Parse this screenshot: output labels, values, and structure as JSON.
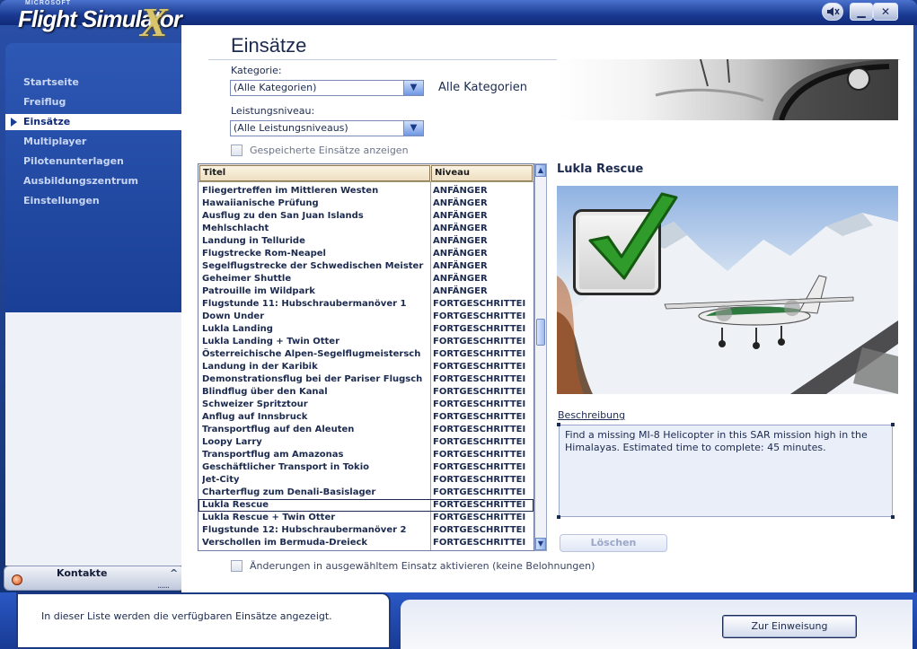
{
  "app": {
    "logo_small": "MICROSOFT",
    "logo_main": "Flight Simulator",
    "logo_x": "X"
  },
  "titlebar": {
    "minimize_label": "▁",
    "close_label": "✕"
  },
  "nav": {
    "items": [
      {
        "label": "Startseite",
        "active": false
      },
      {
        "label": "Freiflug",
        "active": false
      },
      {
        "label": "Einsätze",
        "active": true
      },
      {
        "label": "Multiplayer",
        "active": false
      },
      {
        "label": "Pilotenunterlagen",
        "active": false
      },
      {
        "label": "Ausbildungszentrum",
        "active": false
      },
      {
        "label": "Einstellungen",
        "active": false
      }
    ]
  },
  "contacts": {
    "label": "Kontakte",
    "chevron": "^",
    "grip": "......"
  },
  "page": {
    "title": "Einsätze",
    "category_label": "Kategorie:",
    "category_value": "(Alle Kategorien)",
    "category_display": "Alle Kategorien",
    "level_label": "Leistungsniveau:",
    "level_value": "(Alle Leistungsniveaus)",
    "show_saved_label": "Gespeicherte Einsätze anzeigen"
  },
  "table": {
    "headers": {
      "title": "Titel",
      "level": "Niveau"
    },
    "rows": [
      {
        "title": "Fliegertreffen im Mittleren Westen",
        "level": "ANFÄNGER"
      },
      {
        "title": "Hawaiianische Prüfung",
        "level": "ANFÄNGER"
      },
      {
        "title": "Ausflug zu den San Juan Islands",
        "level": "ANFÄNGER"
      },
      {
        "title": "Mehlschlacht",
        "level": "ANFÄNGER"
      },
      {
        "title": "Landung in Telluride",
        "level": "ANFÄNGER"
      },
      {
        "title": "Flugstrecke Rom-Neapel",
        "level": "ANFÄNGER"
      },
      {
        "title": "Segelflugstrecke der Schwedischen Meister",
        "level": "ANFÄNGER"
      },
      {
        "title": "Geheimer Shuttle",
        "level": "ANFÄNGER"
      },
      {
        "title": "Patrouille im Wildpark",
        "level": "ANFÄNGER"
      },
      {
        "title": "Flugstunde 11: Hubschraubermanöver 1",
        "level": "FORTGESCHRITTEI"
      },
      {
        "title": "Down Under",
        "level": "FORTGESCHRITTEI"
      },
      {
        "title": "Lukla Landing",
        "level": "FORTGESCHRITTEI"
      },
      {
        "title": "Lukla Landing + Twin Otter",
        "level": "FORTGESCHRITTEI"
      },
      {
        "title": "Österreichische Alpen-Segelflugmeistersch",
        "level": "FORTGESCHRITTEI"
      },
      {
        "title": "Landung in der Karibik",
        "level": "FORTGESCHRITTEI"
      },
      {
        "title": "Demonstrationsflug bei der Pariser Flugsch",
        "level": "FORTGESCHRITTEI"
      },
      {
        "title": "Blindflug über den Kanal",
        "level": "FORTGESCHRITTEI"
      },
      {
        "title": "Schweizer Spritztour",
        "level": "FORTGESCHRITTEI"
      },
      {
        "title": "Anflug auf Innsbruck",
        "level": "FORTGESCHRITTEI"
      },
      {
        "title": "Transportflug auf den Aleuten",
        "level": "FORTGESCHRITTEI"
      },
      {
        "title": "Loopy Larry",
        "level": "FORTGESCHRITTEI"
      },
      {
        "title": "Transportflug am Amazonas",
        "level": "FORTGESCHRITTEI"
      },
      {
        "title": "Geschäftlicher Transport in Tokio",
        "level": "FORTGESCHRITTEI"
      },
      {
        "title": "Jet-City",
        "level": "FORTGESCHRITTEI"
      },
      {
        "title": "Charterflug zum Denali-Basislager",
        "level": "FORTGESCHRITTEI"
      },
      {
        "title": "Lukla Rescue",
        "level": "FORTGESCHRITTEI",
        "selected": true
      },
      {
        "title": "Lukla Rescue + Twin Otter",
        "level": "FORTGESCHRITTEI"
      },
      {
        "title": "Flugstunde 12: Hubschraubermanöver 2",
        "level": "FORTGESCHRITTEI"
      },
      {
        "title": "Verschollen im Bermuda-Dreieck",
        "level": "FORTGESCHRITTEI"
      }
    ]
  },
  "scrollbar": {
    "up": "▲",
    "down": "▼",
    "grip": "≡"
  },
  "detail": {
    "mission_title": "Lukla Rescue",
    "description_label": "Beschreibung",
    "description_text": "Find a missing MI-8 Helicopter in this SAR mission high in the Himalayas. Estimated time to complete: 45 minutes.",
    "delete_label": "Löschen",
    "enable_changes_label": "Änderungen in ausgewähltem Einsatz aktivieren (keine Belohnungen)"
  },
  "footer": {
    "status_text": "In dieser Liste werden die verfügbaren Einsätze angezeigt.",
    "briefing_label": "Zur Einweisung"
  },
  "icons": [
    "speaker-muted-icon",
    "minimize-icon",
    "close-icon",
    "dropdown-arrow-icon",
    "checkmark-icon",
    "contact-status-icon",
    "scroll-up-icon",
    "scroll-down-icon"
  ],
  "colors": {
    "frame_blue": "#1e3f8a",
    "nav_blue": "#2d58b4",
    "text_dark": "#1b2a4e",
    "header_beige": "#f5e8d0",
    "checkmark_green": "#2f9b2a",
    "logo_gold": "#d8c46a"
  }
}
